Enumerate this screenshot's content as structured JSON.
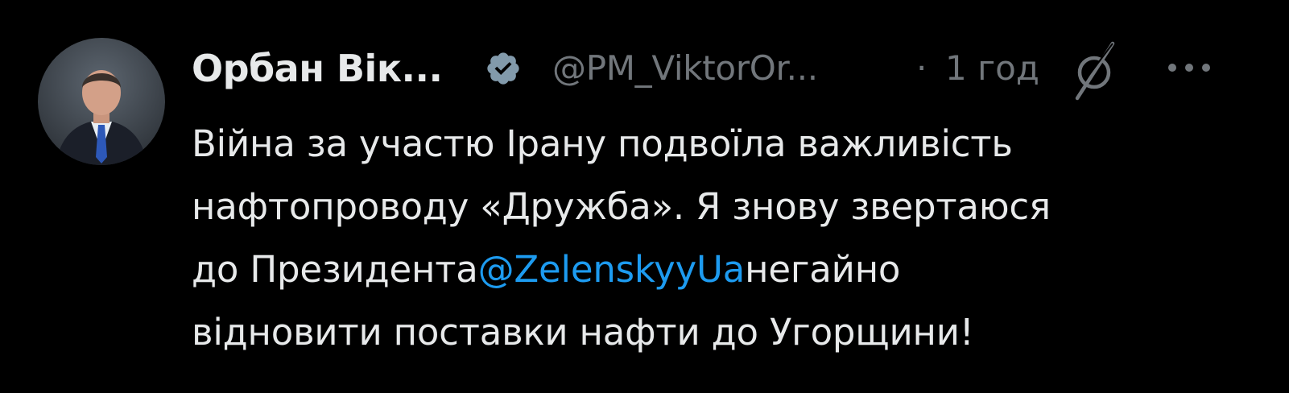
{
  "colors": {
    "background": "#000000",
    "text_primary": "#e7e9ea",
    "text_secondary": "#71767b",
    "link": "#1d9bf0",
    "verified_badge": "#829aab"
  },
  "tweet": {
    "author": {
      "display_name": "Орбан Вік...",
      "handle": "@PM_ViktorOr...",
      "verified": true,
      "verified_icon": "verified-badge-icon",
      "avatar_icon": "profile-photo"
    },
    "separator": "·",
    "time": "1 год",
    "grok_icon": "grok-icon",
    "more_icon": "more-options-icon",
    "text": {
      "line1": "Війна за участю Ірану подвоїла важливість",
      "line2": "нафтопроводу «Дружба». Я знову звертаюся",
      "line3_before": "до Президента",
      "line3_mention": "@ZelenskyyUa",
      "line3_after": "негайно",
      "line4": "відновити поставки нафти до Угорщини!"
    }
  }
}
